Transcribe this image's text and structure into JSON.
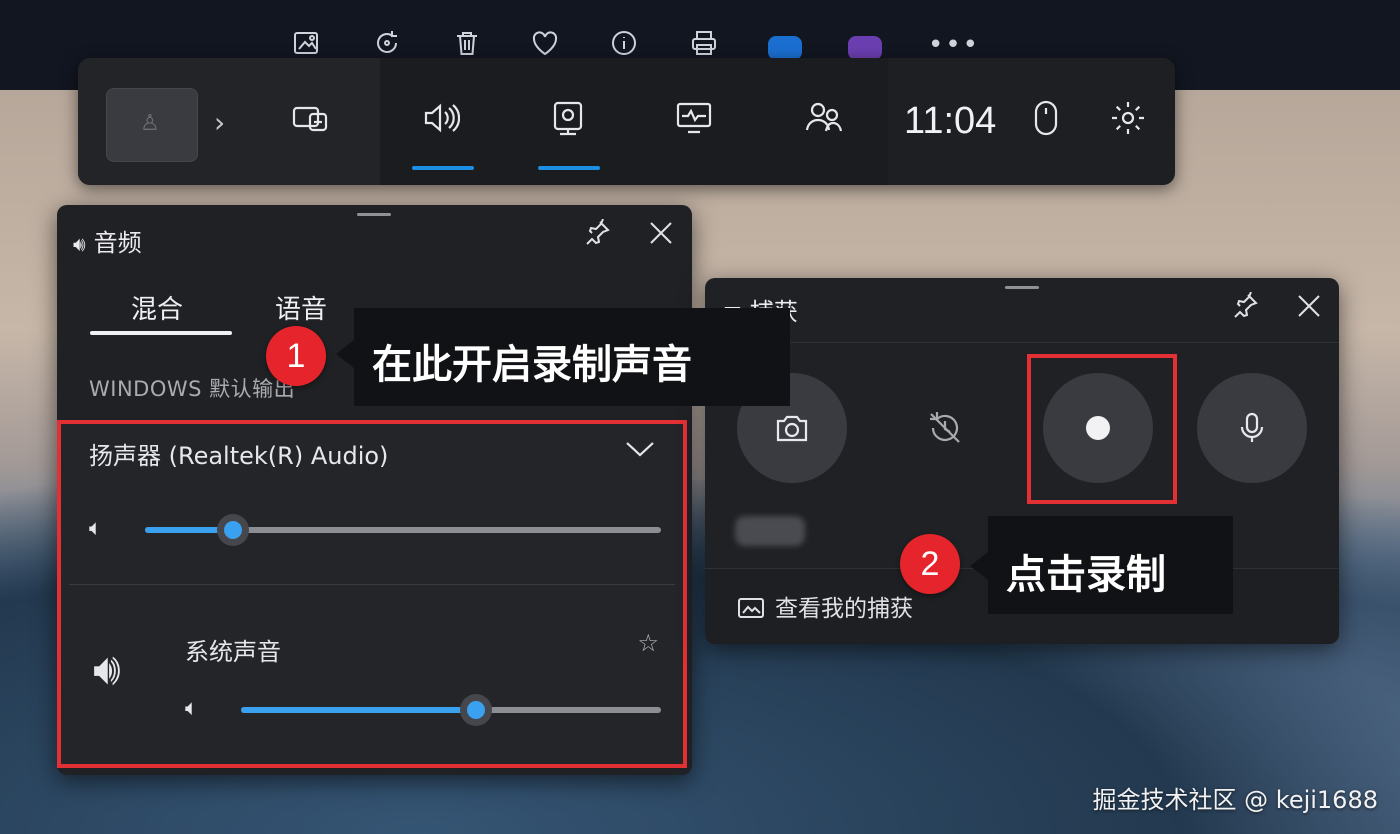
{
  "topbar": {
    "icons": [
      "edit-image-icon",
      "rotate-icon",
      "delete-icon",
      "favorite-icon",
      "info-icon",
      "print-icon",
      "onedrive-icon",
      "app-icon"
    ],
    "more_label": "•••"
  },
  "gamebar": {
    "thumbnail_glyph": "♙",
    "expand_glyph": "›",
    "clock": "11:04",
    "widgets": [
      {
        "name": "widget-menu",
        "active": false
      },
      {
        "name": "audio",
        "active": true
      },
      {
        "name": "capture",
        "active": true
      },
      {
        "name": "performance",
        "active": false
      },
      {
        "name": "social",
        "active": false
      }
    ]
  },
  "audio_panel": {
    "title": "音频",
    "tabs": [
      "混合",
      "语音"
    ],
    "active_tab": "混合",
    "section_label": "WINDOWS 默认输出",
    "device_name": "扬声器 (Realtek(R) Audio)",
    "device_volume_fraction": 0.17,
    "app_name": "系统声音",
    "app_volume_fraction": 0.56,
    "star_glyph": "☆"
  },
  "capture_panel": {
    "title": "捕获",
    "view_captures_label": "查看我的捕获"
  },
  "callouts": [
    {
      "number": "1",
      "text": "在此开启录制声音"
    },
    {
      "number": "2",
      "text": "点击录制"
    }
  ],
  "colors": {
    "accent_blue": "#3aa0f0",
    "highlight_red": "#e23034",
    "badge_red": "#e5242b"
  },
  "watermark": "掘金技术社区 @ keji1688"
}
